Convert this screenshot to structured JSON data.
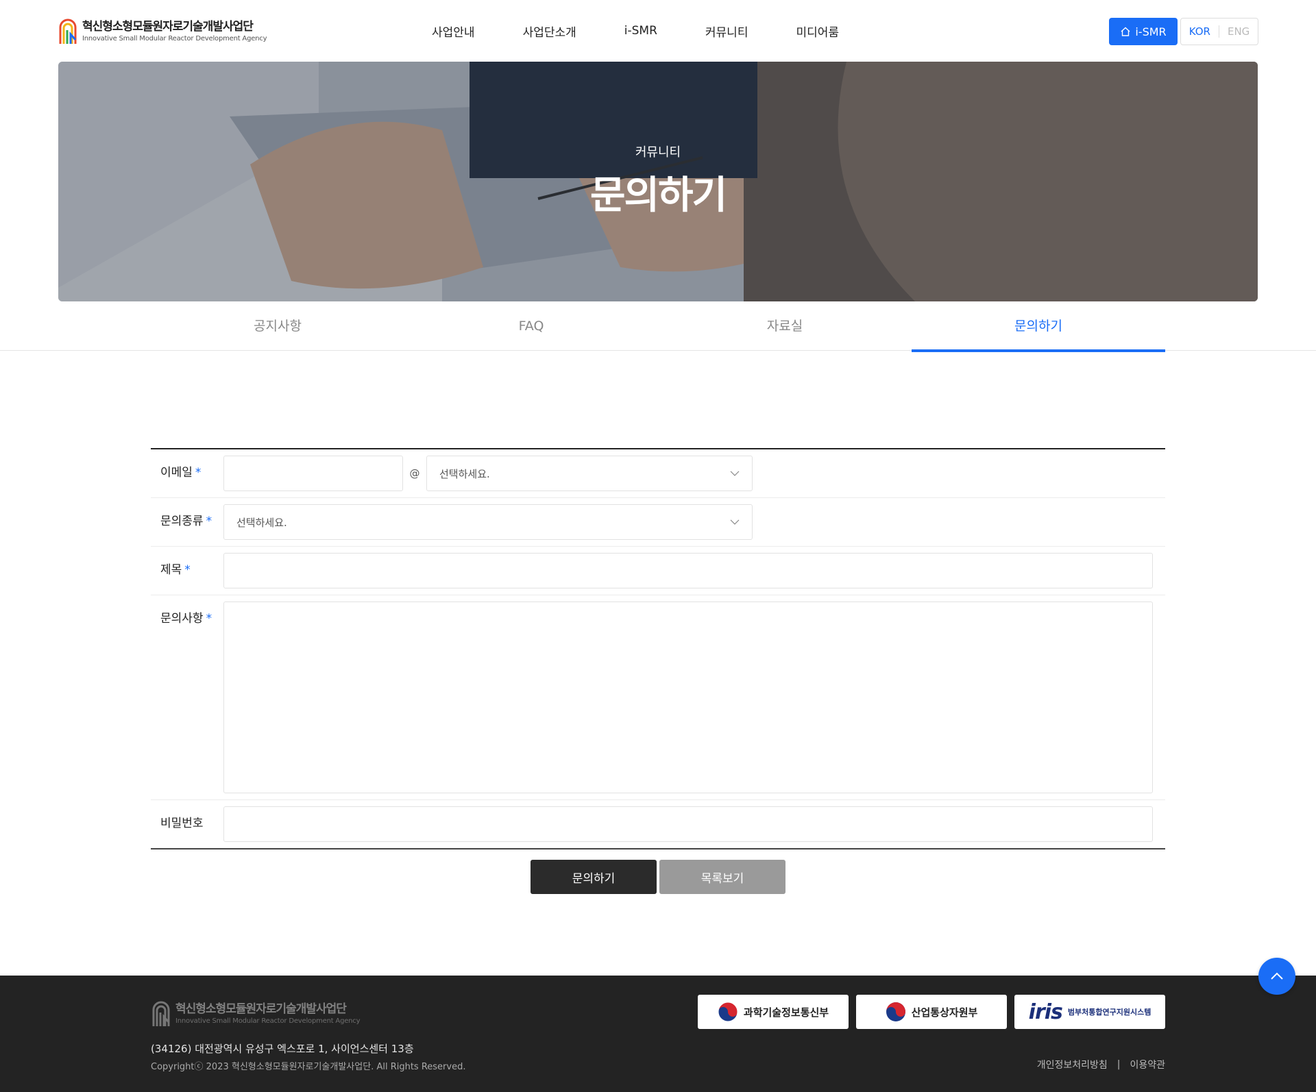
{
  "header": {
    "logo_title": "혁신형소형모듈원자로기술개발사업단",
    "logo_subtitle": "Innovative Small Modular Reactor Development Agency",
    "nav": [
      "사업안내",
      "사업단소개",
      "i-SMR",
      "커뮤니티",
      "미디어룸"
    ],
    "ismr_button": "i-SMR",
    "lang_kor": "KOR",
    "lang_eng": "ENG"
  },
  "hero": {
    "subtitle": "커뮤니티",
    "title": "문의하기"
  },
  "tabs": [
    {
      "label": "공지사항",
      "active": false
    },
    {
      "label": "FAQ",
      "active": false
    },
    {
      "label": "자료실",
      "active": false
    },
    {
      "label": "문의하기",
      "active": true
    }
  ],
  "form": {
    "email_label": "이메일",
    "email_at": "@",
    "email_domain_select": "선택하세요.",
    "type_label": "문의종류",
    "type_select": "선택하세요.",
    "subject_label": "제목",
    "content_label": "문의사항",
    "password_label": "비밀번호",
    "required_mark": "*"
  },
  "buttons": {
    "submit": "문의하기",
    "list": "목록보기"
  },
  "footer": {
    "logo_title": "혁신형소형모듈원자로기술개발사업단",
    "logo_subtitle": "Innovative Small Modular Reactor Development Agency",
    "address": "(34126) 대전광역시 유성구 엑스포로 1, 사이언스센터 13층",
    "copyright": "Copyrightⓒ 2023 혁신형소형모듈원자로기술개발사업단. All Rights Reserved.",
    "banner_1": "과학기술정보통신부",
    "banner_2": "산업통상자원부",
    "banner_3_word": "iris",
    "banner_3_sub": "범부처통합연구지원시스템",
    "link_privacy": "개인정보처리방침",
    "link_sep": "|",
    "link_terms": "이용약관"
  },
  "colors": {
    "accent": "#1a6df6",
    "footer_bg": "#232323",
    "primary_button": "#2b2b2b",
    "secondary_button": "#9a9a9a"
  },
  "icons": [
    "home-icon",
    "chevron-down-icon",
    "arrow-up-icon",
    "logo-icon",
    "taegeuk-icon"
  ]
}
